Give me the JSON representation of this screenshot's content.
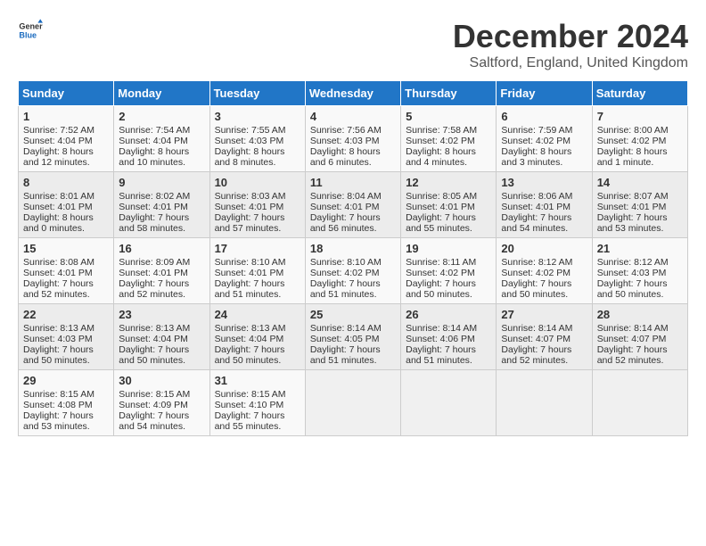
{
  "logo": {
    "general": "General",
    "blue": "Blue"
  },
  "title": "December 2024",
  "subtitle": "Saltford, England, United Kingdom",
  "weekdays": [
    "Sunday",
    "Monday",
    "Tuesday",
    "Wednesday",
    "Thursday",
    "Friday",
    "Saturday"
  ],
  "weeks": [
    [
      {
        "day": "1",
        "sunrise": "Sunrise: 7:52 AM",
        "sunset": "Sunset: 4:04 PM",
        "daylight": "Daylight: 8 hours and 12 minutes."
      },
      {
        "day": "2",
        "sunrise": "Sunrise: 7:54 AM",
        "sunset": "Sunset: 4:04 PM",
        "daylight": "Daylight: 8 hours and 10 minutes."
      },
      {
        "day": "3",
        "sunrise": "Sunrise: 7:55 AM",
        "sunset": "Sunset: 4:03 PM",
        "daylight": "Daylight: 8 hours and 8 minutes."
      },
      {
        "day": "4",
        "sunrise": "Sunrise: 7:56 AM",
        "sunset": "Sunset: 4:03 PM",
        "daylight": "Daylight: 8 hours and 6 minutes."
      },
      {
        "day": "5",
        "sunrise": "Sunrise: 7:58 AM",
        "sunset": "Sunset: 4:02 PM",
        "daylight": "Daylight: 8 hours and 4 minutes."
      },
      {
        "day": "6",
        "sunrise": "Sunrise: 7:59 AM",
        "sunset": "Sunset: 4:02 PM",
        "daylight": "Daylight: 8 hours and 3 minutes."
      },
      {
        "day": "7",
        "sunrise": "Sunrise: 8:00 AM",
        "sunset": "Sunset: 4:02 PM",
        "daylight": "Daylight: 8 hours and 1 minute."
      }
    ],
    [
      {
        "day": "8",
        "sunrise": "Sunrise: 8:01 AM",
        "sunset": "Sunset: 4:01 PM",
        "daylight": "Daylight: 8 hours and 0 minutes."
      },
      {
        "day": "9",
        "sunrise": "Sunrise: 8:02 AM",
        "sunset": "Sunset: 4:01 PM",
        "daylight": "Daylight: 7 hours and 58 minutes."
      },
      {
        "day": "10",
        "sunrise": "Sunrise: 8:03 AM",
        "sunset": "Sunset: 4:01 PM",
        "daylight": "Daylight: 7 hours and 57 minutes."
      },
      {
        "day": "11",
        "sunrise": "Sunrise: 8:04 AM",
        "sunset": "Sunset: 4:01 PM",
        "daylight": "Daylight: 7 hours and 56 minutes."
      },
      {
        "day": "12",
        "sunrise": "Sunrise: 8:05 AM",
        "sunset": "Sunset: 4:01 PM",
        "daylight": "Daylight: 7 hours and 55 minutes."
      },
      {
        "day": "13",
        "sunrise": "Sunrise: 8:06 AM",
        "sunset": "Sunset: 4:01 PM",
        "daylight": "Daylight: 7 hours and 54 minutes."
      },
      {
        "day": "14",
        "sunrise": "Sunrise: 8:07 AM",
        "sunset": "Sunset: 4:01 PM",
        "daylight": "Daylight: 7 hours and 53 minutes."
      }
    ],
    [
      {
        "day": "15",
        "sunrise": "Sunrise: 8:08 AM",
        "sunset": "Sunset: 4:01 PM",
        "daylight": "Daylight: 7 hours and 52 minutes."
      },
      {
        "day": "16",
        "sunrise": "Sunrise: 8:09 AM",
        "sunset": "Sunset: 4:01 PM",
        "daylight": "Daylight: 7 hours and 52 minutes."
      },
      {
        "day": "17",
        "sunrise": "Sunrise: 8:10 AM",
        "sunset": "Sunset: 4:01 PM",
        "daylight": "Daylight: 7 hours and 51 minutes."
      },
      {
        "day": "18",
        "sunrise": "Sunrise: 8:10 AM",
        "sunset": "Sunset: 4:02 PM",
        "daylight": "Daylight: 7 hours and 51 minutes."
      },
      {
        "day": "19",
        "sunrise": "Sunrise: 8:11 AM",
        "sunset": "Sunset: 4:02 PM",
        "daylight": "Daylight: 7 hours and 50 minutes."
      },
      {
        "day": "20",
        "sunrise": "Sunrise: 8:12 AM",
        "sunset": "Sunset: 4:02 PM",
        "daylight": "Daylight: 7 hours and 50 minutes."
      },
      {
        "day": "21",
        "sunrise": "Sunrise: 8:12 AM",
        "sunset": "Sunset: 4:03 PM",
        "daylight": "Daylight: 7 hours and 50 minutes."
      }
    ],
    [
      {
        "day": "22",
        "sunrise": "Sunrise: 8:13 AM",
        "sunset": "Sunset: 4:03 PM",
        "daylight": "Daylight: 7 hours and 50 minutes."
      },
      {
        "day": "23",
        "sunrise": "Sunrise: 8:13 AM",
        "sunset": "Sunset: 4:04 PM",
        "daylight": "Daylight: 7 hours and 50 minutes."
      },
      {
        "day": "24",
        "sunrise": "Sunrise: 8:13 AM",
        "sunset": "Sunset: 4:04 PM",
        "daylight": "Daylight: 7 hours and 50 minutes."
      },
      {
        "day": "25",
        "sunrise": "Sunrise: 8:14 AM",
        "sunset": "Sunset: 4:05 PM",
        "daylight": "Daylight: 7 hours and 51 minutes."
      },
      {
        "day": "26",
        "sunrise": "Sunrise: 8:14 AM",
        "sunset": "Sunset: 4:06 PM",
        "daylight": "Daylight: 7 hours and 51 minutes."
      },
      {
        "day": "27",
        "sunrise": "Sunrise: 8:14 AM",
        "sunset": "Sunset: 4:07 PM",
        "daylight": "Daylight: 7 hours and 52 minutes."
      },
      {
        "day": "28",
        "sunrise": "Sunrise: 8:14 AM",
        "sunset": "Sunset: 4:07 PM",
        "daylight": "Daylight: 7 hours and 52 minutes."
      }
    ],
    [
      {
        "day": "29",
        "sunrise": "Sunrise: 8:15 AM",
        "sunset": "Sunset: 4:08 PM",
        "daylight": "Daylight: 7 hours and 53 minutes."
      },
      {
        "day": "30",
        "sunrise": "Sunrise: 8:15 AM",
        "sunset": "Sunset: 4:09 PM",
        "daylight": "Daylight: 7 hours and 54 minutes."
      },
      {
        "day": "31",
        "sunrise": "Sunrise: 8:15 AM",
        "sunset": "Sunset: 4:10 PM",
        "daylight": "Daylight: 7 hours and 55 minutes."
      },
      null,
      null,
      null,
      null
    ]
  ]
}
